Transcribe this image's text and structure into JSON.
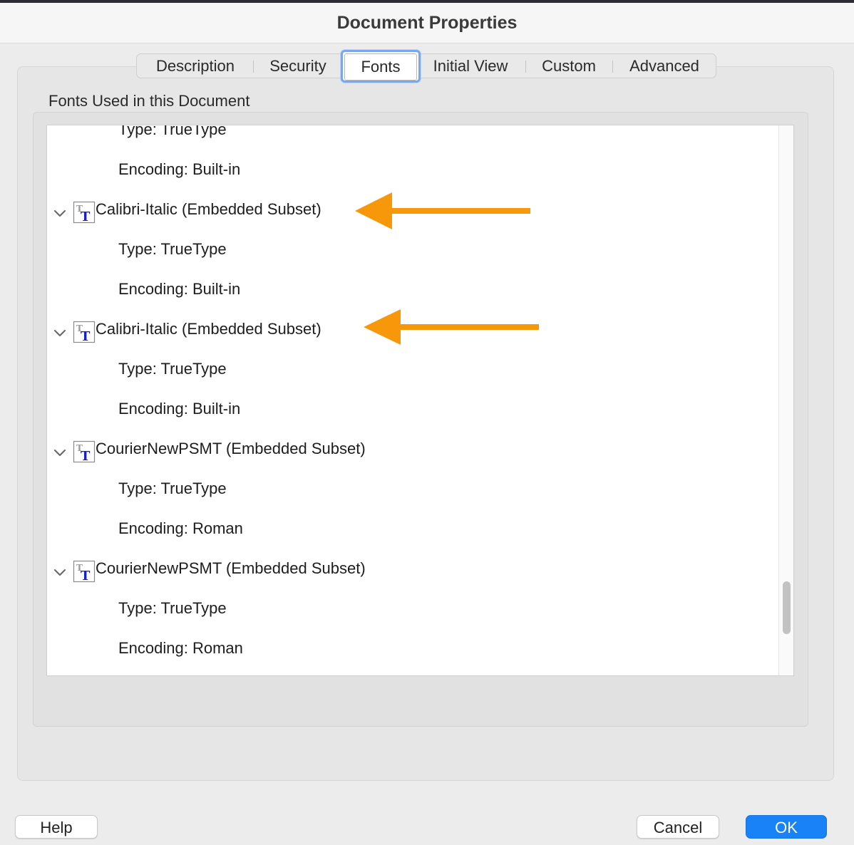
{
  "window": {
    "title": "Document Properties"
  },
  "tabs": [
    {
      "label": "Description"
    },
    {
      "label": "Security"
    },
    {
      "label": "Fonts",
      "active": true
    },
    {
      "label": "Initial View"
    },
    {
      "label": "Custom"
    },
    {
      "label": "Advanced"
    }
  ],
  "fonts_panel": {
    "section_label": "Fonts Used in this Document",
    "partial_top": {
      "type": "Type: TrueType",
      "encoding": "Encoding: Built-in"
    },
    "fonts": [
      {
        "name": "Calibri-Italic (Embedded Subset)",
        "type": "Type: TrueType",
        "encoding": "Encoding: Built-in",
        "annotated": true
      },
      {
        "name": "Calibri-Italic (Embedded Subset)",
        "type": "Type: TrueType",
        "encoding": "Encoding: Built-in",
        "annotated": true
      },
      {
        "name": "CourierNewPSMT (Embedded Subset)",
        "type": "Type: TrueType",
        "encoding": "Encoding: Roman",
        "annotated": false
      },
      {
        "name": "CourierNewPSMT (Embedded Subset)",
        "type": "Type: TrueType",
        "encoding": "Encoding: Roman",
        "annotated": false
      }
    ],
    "icons": {
      "expand": "chevron-down-icon",
      "font": "truetype-font-icon",
      "annotation": "arrow-left-icon"
    },
    "annotation_color": "#f7970a"
  },
  "buttons": {
    "help": "Help",
    "cancel": "Cancel",
    "ok": "OK"
  },
  "colors": {
    "accent": "#1a82f7",
    "tab_focus": "#79a6ee"
  }
}
